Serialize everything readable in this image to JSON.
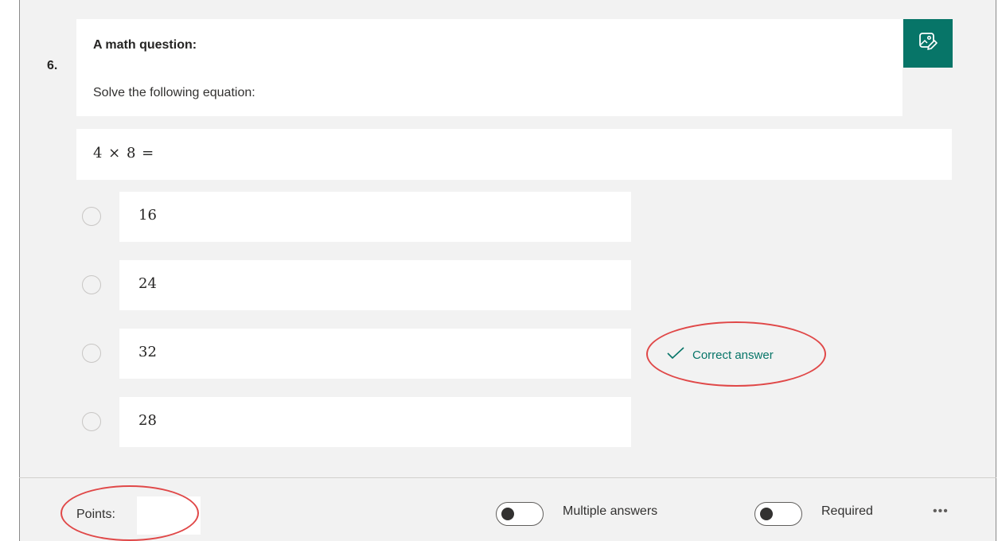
{
  "question": {
    "number": "6.",
    "title": "A math question:",
    "subtitle": "Solve the following equation:",
    "equation": "4 × 8 =",
    "image_button_icon": "image-edit-icon"
  },
  "options": [
    {
      "label": "16",
      "correct": false
    },
    {
      "label": "24",
      "correct": false
    },
    {
      "label": "32",
      "correct": true
    },
    {
      "label": "28",
      "correct": false
    }
  ],
  "correct_marker": {
    "icon": "checkmark-icon",
    "label": "Correct answer"
  },
  "footer": {
    "points_label": "Points:",
    "points_value": "",
    "multiple_answers_label": "Multiple answers",
    "multiple_answers_on": false,
    "required_label": "Required",
    "required_on": false,
    "more_icon": "more-options-icon"
  },
  "colors": {
    "accent": "#077568",
    "annotation": "#e04848",
    "card_background": "#f2f2f2"
  }
}
